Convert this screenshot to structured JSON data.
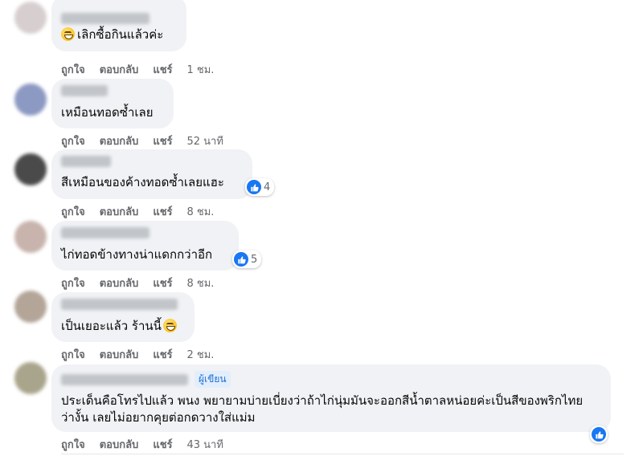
{
  "actions": {
    "like": "ถูกใจ",
    "reply": "ตอบกลับ",
    "share": "แชร์"
  },
  "author_badge": "ผู้เขียน",
  "comments": [
    {
      "text": "เลิกซื้อกินแล้วค่ะ",
      "time": "1 ชม.",
      "avatar_color": "#d7cfcf",
      "has_emoji_prefix": true
    },
    {
      "text": "เหมือนทอดซ้ำเลย",
      "time": "52 นาที",
      "avatar_color": "#8c99c2"
    },
    {
      "text": "สีเหมือนของค้างทอดซ้ำเลยแฮะ",
      "time": "8 ชม.",
      "avatar_color": "#4a4a4a",
      "reactions": "4"
    },
    {
      "text": "ไก่ทอดข้างทางน่าแดกกว่าอีก",
      "time": "8 ชม.",
      "avatar_color": "#c8b3ad",
      "reactions": "5"
    },
    {
      "text": "เป็นเยอะแล้ว ร้านนี้",
      "time": "2 ชม.",
      "avatar_color": "#b3a598",
      "has_emoji_suffix": true
    },
    {
      "text": "ประเด็นคือโทรไปแล้ว พนง พยายามบ่ายเบี่ยงว่าถ้าไก่นุ่มมันจะออกสีน้ำตาลหน่อยค่ะเป็นสีของพริกไทยว่างั้น เลยไม่อยากคุยต่อกดวางใส่แม่ม",
      "time": "43 นาที",
      "avatar_color": "#a9a58c",
      "is_author": true
    }
  ]
}
